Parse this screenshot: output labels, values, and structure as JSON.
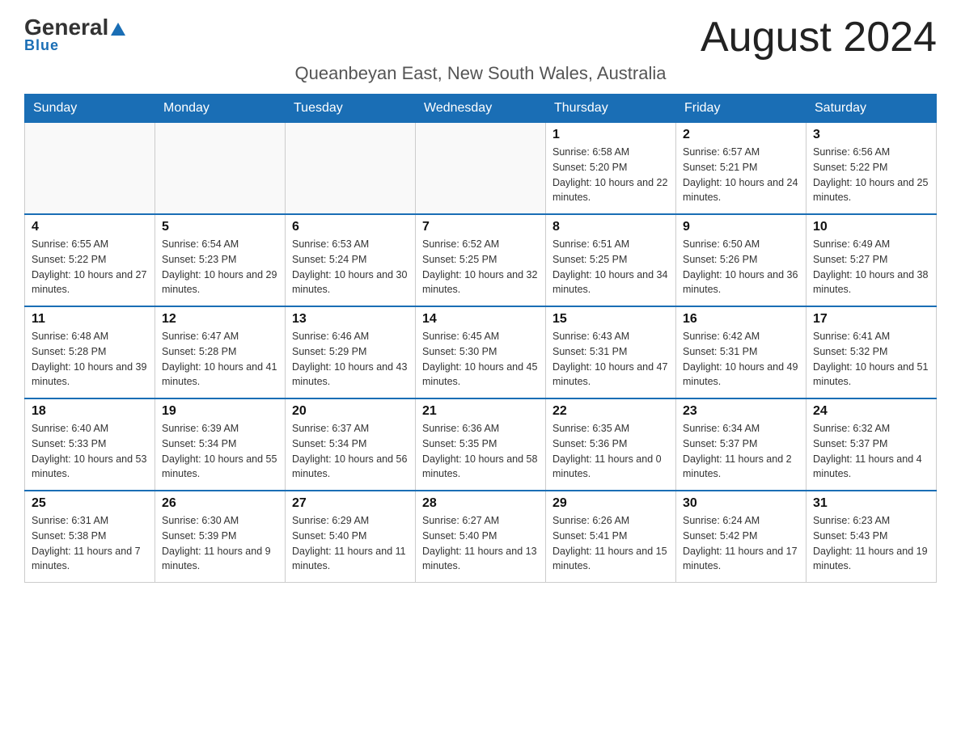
{
  "header": {
    "logo_text": "General",
    "logo_blue": "Blue",
    "month_title": "August 2024",
    "location": "Queanbeyan East, New South Wales, Australia"
  },
  "weekdays": [
    "Sunday",
    "Monday",
    "Tuesday",
    "Wednesday",
    "Thursday",
    "Friday",
    "Saturday"
  ],
  "weeks": [
    [
      {
        "day": "",
        "info": ""
      },
      {
        "day": "",
        "info": ""
      },
      {
        "day": "",
        "info": ""
      },
      {
        "day": "",
        "info": ""
      },
      {
        "day": "1",
        "info": "Sunrise: 6:58 AM\nSunset: 5:20 PM\nDaylight: 10 hours and 22 minutes."
      },
      {
        "day": "2",
        "info": "Sunrise: 6:57 AM\nSunset: 5:21 PM\nDaylight: 10 hours and 24 minutes."
      },
      {
        "day": "3",
        "info": "Sunrise: 6:56 AM\nSunset: 5:22 PM\nDaylight: 10 hours and 25 minutes."
      }
    ],
    [
      {
        "day": "4",
        "info": "Sunrise: 6:55 AM\nSunset: 5:22 PM\nDaylight: 10 hours and 27 minutes."
      },
      {
        "day": "5",
        "info": "Sunrise: 6:54 AM\nSunset: 5:23 PM\nDaylight: 10 hours and 29 minutes."
      },
      {
        "day": "6",
        "info": "Sunrise: 6:53 AM\nSunset: 5:24 PM\nDaylight: 10 hours and 30 minutes."
      },
      {
        "day": "7",
        "info": "Sunrise: 6:52 AM\nSunset: 5:25 PM\nDaylight: 10 hours and 32 minutes."
      },
      {
        "day": "8",
        "info": "Sunrise: 6:51 AM\nSunset: 5:25 PM\nDaylight: 10 hours and 34 minutes."
      },
      {
        "day": "9",
        "info": "Sunrise: 6:50 AM\nSunset: 5:26 PM\nDaylight: 10 hours and 36 minutes."
      },
      {
        "day": "10",
        "info": "Sunrise: 6:49 AM\nSunset: 5:27 PM\nDaylight: 10 hours and 38 minutes."
      }
    ],
    [
      {
        "day": "11",
        "info": "Sunrise: 6:48 AM\nSunset: 5:28 PM\nDaylight: 10 hours and 39 minutes."
      },
      {
        "day": "12",
        "info": "Sunrise: 6:47 AM\nSunset: 5:28 PM\nDaylight: 10 hours and 41 minutes."
      },
      {
        "day": "13",
        "info": "Sunrise: 6:46 AM\nSunset: 5:29 PM\nDaylight: 10 hours and 43 minutes."
      },
      {
        "day": "14",
        "info": "Sunrise: 6:45 AM\nSunset: 5:30 PM\nDaylight: 10 hours and 45 minutes."
      },
      {
        "day": "15",
        "info": "Sunrise: 6:43 AM\nSunset: 5:31 PM\nDaylight: 10 hours and 47 minutes."
      },
      {
        "day": "16",
        "info": "Sunrise: 6:42 AM\nSunset: 5:31 PM\nDaylight: 10 hours and 49 minutes."
      },
      {
        "day": "17",
        "info": "Sunrise: 6:41 AM\nSunset: 5:32 PM\nDaylight: 10 hours and 51 minutes."
      }
    ],
    [
      {
        "day": "18",
        "info": "Sunrise: 6:40 AM\nSunset: 5:33 PM\nDaylight: 10 hours and 53 minutes."
      },
      {
        "day": "19",
        "info": "Sunrise: 6:39 AM\nSunset: 5:34 PM\nDaylight: 10 hours and 55 minutes."
      },
      {
        "day": "20",
        "info": "Sunrise: 6:37 AM\nSunset: 5:34 PM\nDaylight: 10 hours and 56 minutes."
      },
      {
        "day": "21",
        "info": "Sunrise: 6:36 AM\nSunset: 5:35 PM\nDaylight: 10 hours and 58 minutes."
      },
      {
        "day": "22",
        "info": "Sunrise: 6:35 AM\nSunset: 5:36 PM\nDaylight: 11 hours and 0 minutes."
      },
      {
        "day": "23",
        "info": "Sunrise: 6:34 AM\nSunset: 5:37 PM\nDaylight: 11 hours and 2 minutes."
      },
      {
        "day": "24",
        "info": "Sunrise: 6:32 AM\nSunset: 5:37 PM\nDaylight: 11 hours and 4 minutes."
      }
    ],
    [
      {
        "day": "25",
        "info": "Sunrise: 6:31 AM\nSunset: 5:38 PM\nDaylight: 11 hours and 7 minutes."
      },
      {
        "day": "26",
        "info": "Sunrise: 6:30 AM\nSunset: 5:39 PM\nDaylight: 11 hours and 9 minutes."
      },
      {
        "day": "27",
        "info": "Sunrise: 6:29 AM\nSunset: 5:40 PM\nDaylight: 11 hours and 11 minutes."
      },
      {
        "day": "28",
        "info": "Sunrise: 6:27 AM\nSunset: 5:40 PM\nDaylight: 11 hours and 13 minutes."
      },
      {
        "day": "29",
        "info": "Sunrise: 6:26 AM\nSunset: 5:41 PM\nDaylight: 11 hours and 15 minutes."
      },
      {
        "day": "30",
        "info": "Sunrise: 6:24 AM\nSunset: 5:42 PM\nDaylight: 11 hours and 17 minutes."
      },
      {
        "day": "31",
        "info": "Sunrise: 6:23 AM\nSunset: 5:43 PM\nDaylight: 11 hours and 19 minutes."
      }
    ]
  ]
}
